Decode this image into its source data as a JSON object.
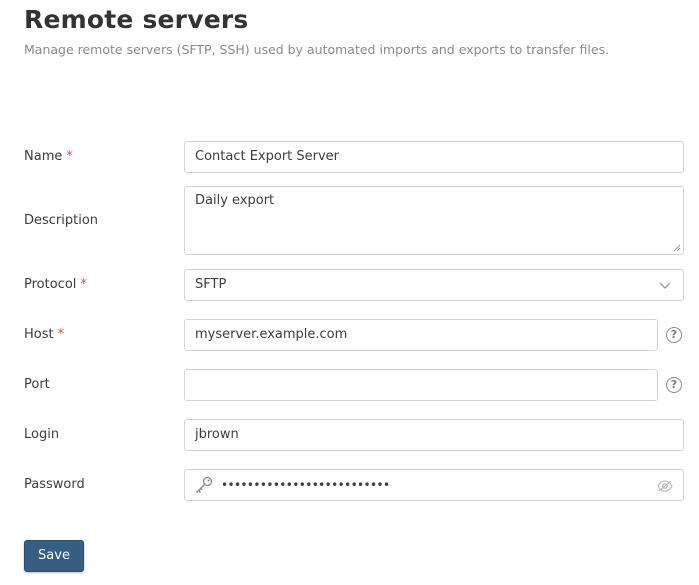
{
  "page": {
    "title": "Remote servers",
    "subtitle": "Manage remote servers (SFTP, SSH) used by automated imports and exports to transfer files."
  },
  "form": {
    "name": {
      "label": "Name",
      "required_mark": "*",
      "value": "Contact Export Server"
    },
    "description": {
      "label": "Description",
      "value": "Daily export"
    },
    "protocol": {
      "label": "Protocol",
      "required_mark": "*",
      "value": "SFTP"
    },
    "host": {
      "label": "Host",
      "required_mark": "*",
      "value": "myserver.example.com",
      "help_icon": "question-circle-icon"
    },
    "port": {
      "label": "Port",
      "value": "",
      "help_icon": "question-circle-icon"
    },
    "login": {
      "label": "Login",
      "value": "jbrown"
    },
    "password": {
      "label": "Password",
      "value": "••••••••••••••••••••••••••",
      "key_icon": "key-icon",
      "toggle_icon": "eye-slash-icon"
    }
  },
  "actions": {
    "save_label": "Save"
  },
  "colors": {
    "primary": "#355e82",
    "required": "#d9534f",
    "border": "#d3d3d3"
  }
}
